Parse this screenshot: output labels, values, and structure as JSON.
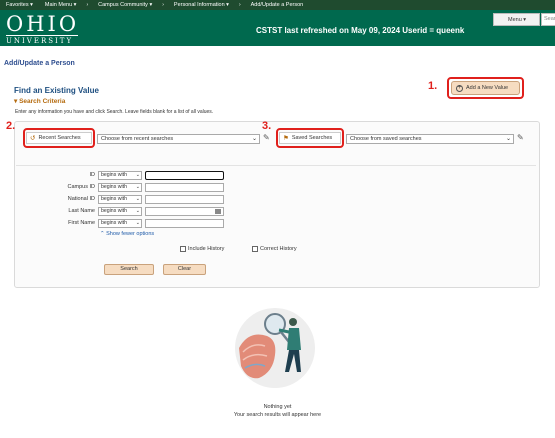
{
  "topnav": {
    "items": [
      "Favorites",
      "Main Menu",
      "Campus Community",
      "Personal Information",
      "Add/Update a Person"
    ]
  },
  "banner": {
    "logo_main": "OHIO",
    "logo_sub": "UNIVERSITY",
    "refresh_text": "CSTST last refreshed on May 09, 2024 Userid = queenk",
    "menu_label": "Menu",
    "search_placeholder": "Sear"
  },
  "page": {
    "title": "Add/Update a Person",
    "find_title": "Find an Existing Value",
    "criteria_title": "Search Criteria",
    "hint": "Enter any information you have and click Search. Leave fields blank for a list of all values."
  },
  "annotations": [
    "1.",
    "2.",
    "3."
  ],
  "add_button": "Add a New Value",
  "recent": {
    "button": "Recent Searches",
    "placeholder": "Choose from recent searches"
  },
  "saved": {
    "button": "Saved Searches",
    "placeholder": "Choose from saved searches"
  },
  "fields": [
    {
      "label": "ID",
      "operator": "begins with"
    },
    {
      "label": "Campus ID",
      "operator": "begins with"
    },
    {
      "label": "National ID",
      "operator": "begins with"
    },
    {
      "label": "Last Name",
      "operator": "begins with"
    },
    {
      "label": "First Name",
      "operator": "begins with"
    }
  ],
  "fewer_options": "Show fewer options",
  "include_history": "Include History",
  "correct_history": "Correct History",
  "search_button": "Search",
  "clear_button": "Clear",
  "empty_state": {
    "title": "Nothing yet",
    "subtitle": "Your search results will appear here"
  },
  "colors": {
    "brand_green": "#00694e",
    "nav_green": "#1f4b2f",
    "annotation_red": "#e0201c",
    "button_peach": "#f6dcc1",
    "link_blue": "#1e5aa8"
  }
}
